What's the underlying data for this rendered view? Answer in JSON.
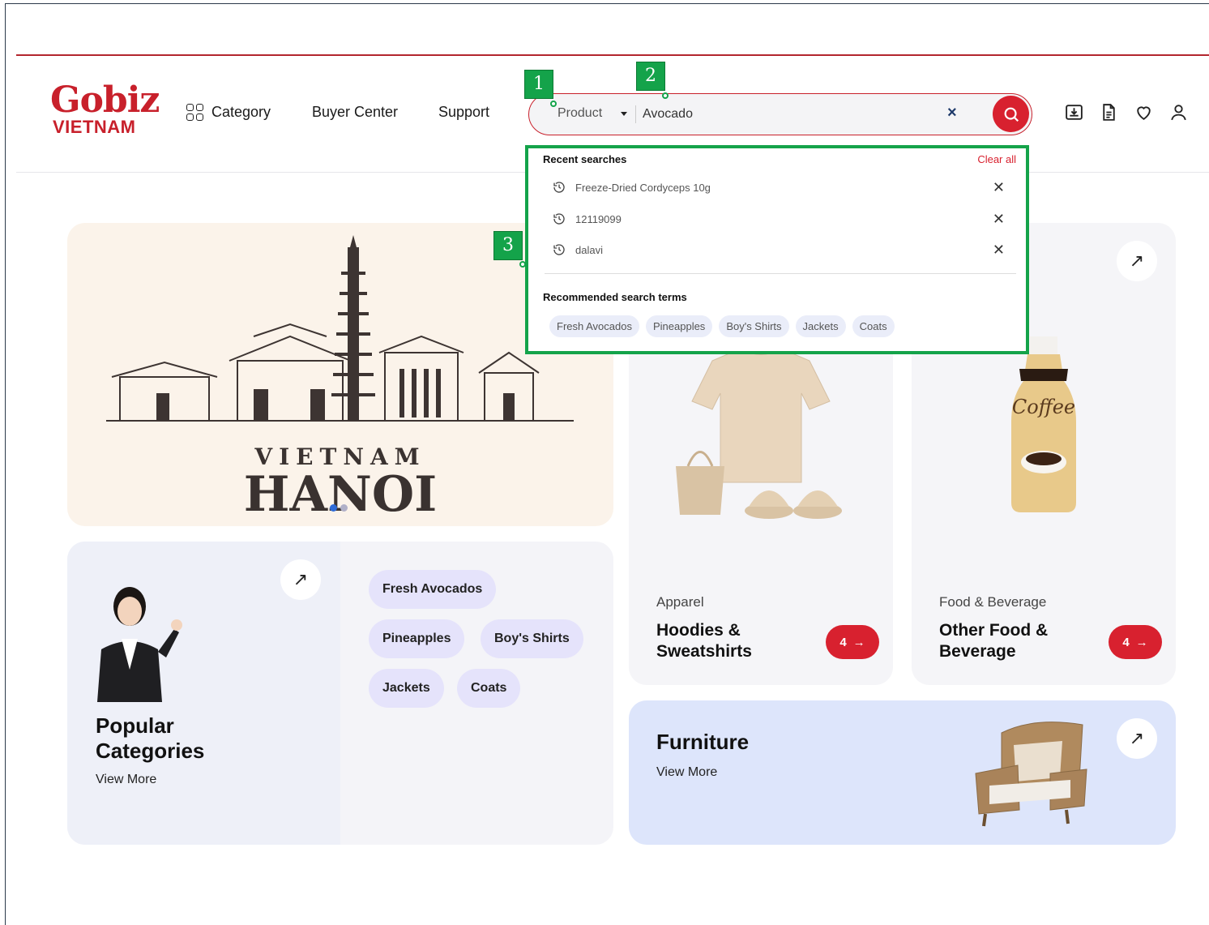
{
  "header": {
    "logo_top": "Gobiz",
    "logo_bottom": "VIETNAM",
    "nav": {
      "category": "Category",
      "buyer_center": "Buyer Center",
      "support": "Support"
    },
    "icons": [
      "import-box-icon",
      "document-icon",
      "heart-icon",
      "user-icon"
    ]
  },
  "search": {
    "type_selected": "Product",
    "value": "Avocado",
    "clear_symbol": "×"
  },
  "markers": {
    "m1": "1",
    "m2": "2",
    "m3": "3"
  },
  "dropdown": {
    "recent_title": "Recent searches",
    "clear_all": "Clear all",
    "recent": [
      "Freeze-Dried Cordyceps 10g",
      "12119099",
      "dalavi"
    ],
    "recommended_title": "Recommended search terms",
    "recommended": [
      "Fresh Avocados",
      "Pineapples",
      "Boy's Shirts",
      "Jackets",
      "Coats"
    ]
  },
  "banner": {
    "country": "VIETNAM",
    "city": "HANOI"
  },
  "popular": {
    "title": "Popular Categories",
    "view_more": "View More",
    "chips": [
      "Fresh Avocados",
      "Pineapples",
      "Boy's Shirts",
      "Jackets",
      "Coats"
    ]
  },
  "apparel": {
    "label": "Apparel",
    "title": "Hoodies & Sweatshirts",
    "count": "4"
  },
  "food": {
    "label": "Food & Beverage",
    "title": "Other Food & Beverage",
    "count": "4"
  },
  "furniture": {
    "title": "Furniture",
    "view_more": "View More"
  },
  "colors": {
    "brand_red": "#c8202b",
    "marker_green": "#14a34a",
    "chip_bg": "#e5e3fb"
  }
}
